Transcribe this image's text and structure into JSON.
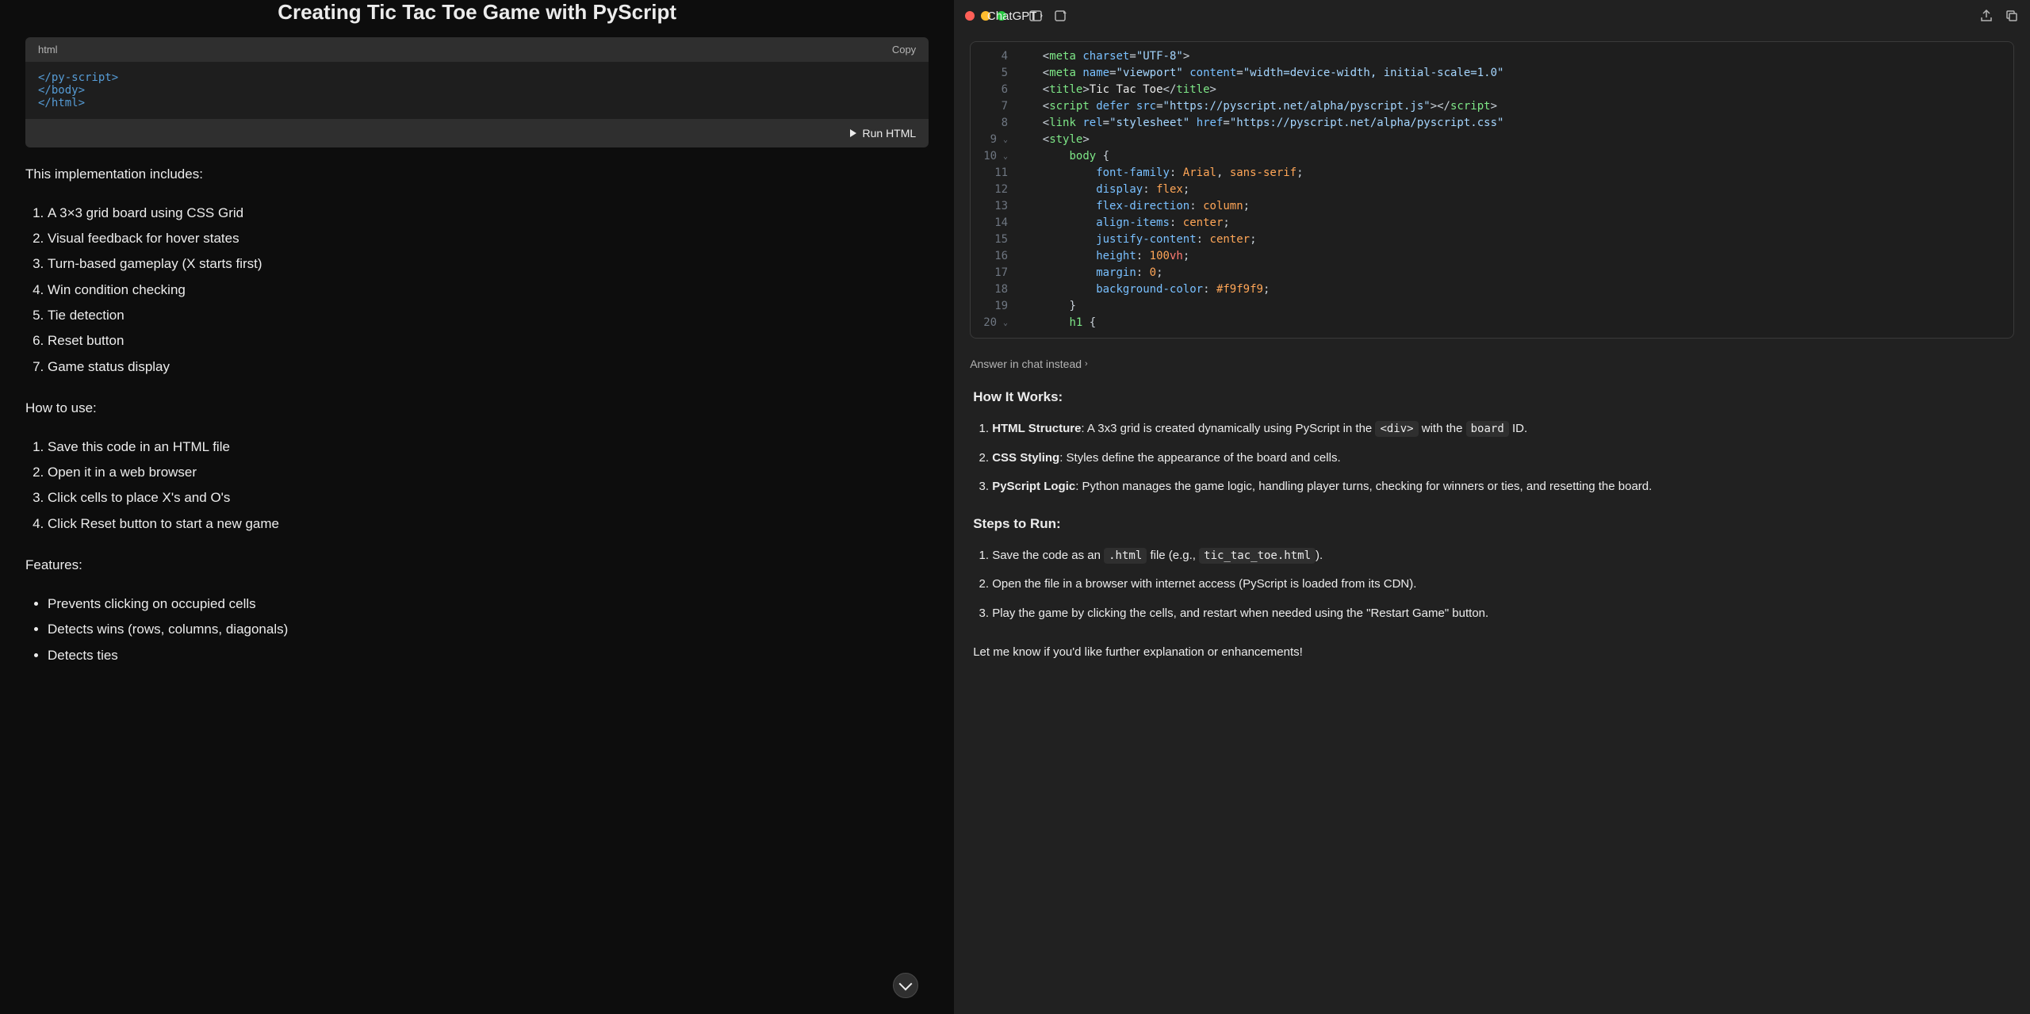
{
  "left": {
    "title": "Creating Tic Tac Toe Game with PyScript",
    "code_header": {
      "lang": "html",
      "copy": "Copy"
    },
    "code_snippet": {
      "line1": "</py-script>",
      "line2": "</body>",
      "line3": "</html>"
    },
    "run_button": "Run HTML",
    "intro": "This implementation includes:",
    "impl_list": [
      "A 3×3 grid board using CSS Grid",
      "Visual feedback for hover states",
      "Turn-based gameplay (X starts first)",
      "Win condition checking",
      "Tie detection",
      "Reset button",
      "Game status display"
    ],
    "how_to_use": "How to use:",
    "use_list": [
      "Save this code in an HTML file",
      "Open it in a web browser",
      "Click cells to place X's and O's",
      "Click Reset button to start a new game"
    ],
    "features": "Features:",
    "features_list": [
      "Prevents clicking on occupied cells",
      "Detects wins (rows, columns, diagonals)",
      "Detects ties"
    ]
  },
  "right": {
    "titlebar_app": "ChatGPT",
    "answer_link": "Answer in chat instead",
    "how_works": "How It Works:",
    "li1_bold": "HTML Structure",
    "li1_text_a": ": A 3x3 grid is created dynamically using PyScript in the ",
    "li1_code_a": "<div>",
    "li1_text_b": " with the ",
    "li1_code_b": "board",
    "li1_text_c": " ID.",
    "li2_bold": "CSS Styling",
    "li2_text": ": Styles define the appearance of the board and cells.",
    "li3_bold": "PyScript Logic",
    "li3_text": ": Python manages the game logic, handling player turns, checking for winners or ties, and resetting the board.",
    "steps": "Steps to Run:",
    "step1_a": "Save the code as an ",
    "step1_code_a": ".html",
    "step1_b": " file (e.g., ",
    "step1_code_b": "tic_tac_toe.html",
    "step1_c": ").",
    "step2": "Open the file in a browser with internet access (PyScript is loaded from its CDN).",
    "step3": "Play the game by clicking the cells, and restart when needed using the \"Restart Game\" button.",
    "closing": "Let me know if you'd like further explanation or enhancements!",
    "gutter": [
      "4",
      "5",
      "6",
      "7",
      "8",
      "9",
      "10",
      "11",
      "12",
      "13",
      "14",
      "15",
      "16",
      "17",
      "18",
      "19",
      "20"
    ]
  }
}
